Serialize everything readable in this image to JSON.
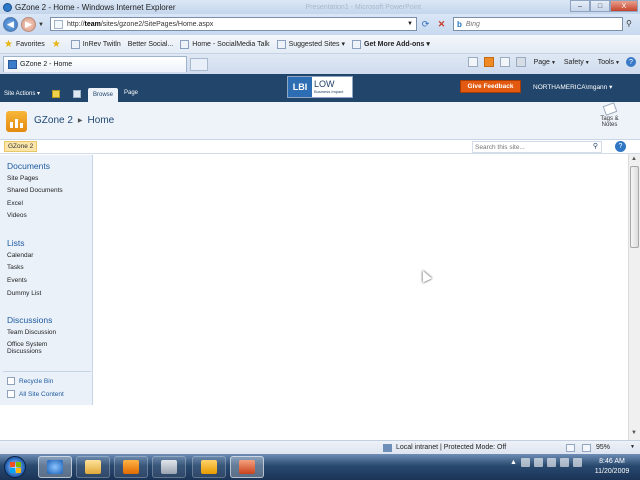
{
  "window": {
    "title": "GZone 2 - Home - Windows Internet Explorer",
    "ghost_title": "Presentation1 - Microsoft PowerPoint",
    "buttons": {
      "minimize": "–",
      "maximize": "□",
      "close": "X"
    }
  },
  "address_bar": {
    "url_prefix": "http://",
    "url_host": "team",
    "url_path": "/sites/gzone2/SitePages/Home.aspx",
    "search_placeholder": "Bing"
  },
  "favorites_bar": {
    "favorites_label": "Favorites",
    "items": [
      {
        "label": "InRev Twitln",
        "icon": "web-slice-icon"
      },
      {
        "label": "Better Social...",
        "icon": "page-icon"
      },
      {
        "label": "Home - SocialMedia Talk",
        "icon": "page-icon"
      },
      {
        "label": "Suggested Sites ▾",
        "icon": "suggested-sites-icon"
      },
      {
        "label": "Get More Add-ons ▾",
        "icon": "addons-icon"
      }
    ]
  },
  "tab": {
    "label": "GZone 2 - Home"
  },
  "command_bar": {
    "page": "Page",
    "safety": "Safety",
    "tools": "Tools"
  },
  "sharepoint": {
    "site_actions": "Site Actions ▾",
    "ribbon_tabs": {
      "browse": "Browse",
      "page": "Page"
    },
    "lbi": {
      "left": "LBI",
      "big": "LOW",
      "small": "Business Impact"
    },
    "give_feedback": "Give Feedback",
    "user": "NORTHAMERICA\\mgann ▾",
    "site_title": "GZone 2",
    "page_title": "Home",
    "tags_notes": [
      "Tags &",
      "Notes"
    ],
    "top_link": "GZone 2",
    "site_search_placeholder": "Search this site...",
    "quick_launch": {
      "documents": {
        "heading": "Documents",
        "items": [
          "Site Pages",
          "Shared Documents",
          "Excel",
          "Videos"
        ]
      },
      "lists": {
        "heading": "Lists",
        "items": [
          "Calendar",
          "Tasks",
          "Events",
          "Dummy List"
        ]
      },
      "discussions": {
        "heading": "Discussions",
        "items": [
          "Team Discussion",
          "Office System",
          "Discussions"
        ]
      },
      "recycle_bin": "Recycle Bin",
      "all_site_content": "All Site Content"
    }
  },
  "status_bar": {
    "zone": "Local intranet | Protected Mode: Off",
    "zoom": "95%"
  },
  "taskbar": {
    "time": "8:46 AM",
    "date": "11/20/2009"
  },
  "colors": {
    "ribbon": "#21456b",
    "feedback": "#e2590f",
    "link": "#1f5aa0"
  }
}
